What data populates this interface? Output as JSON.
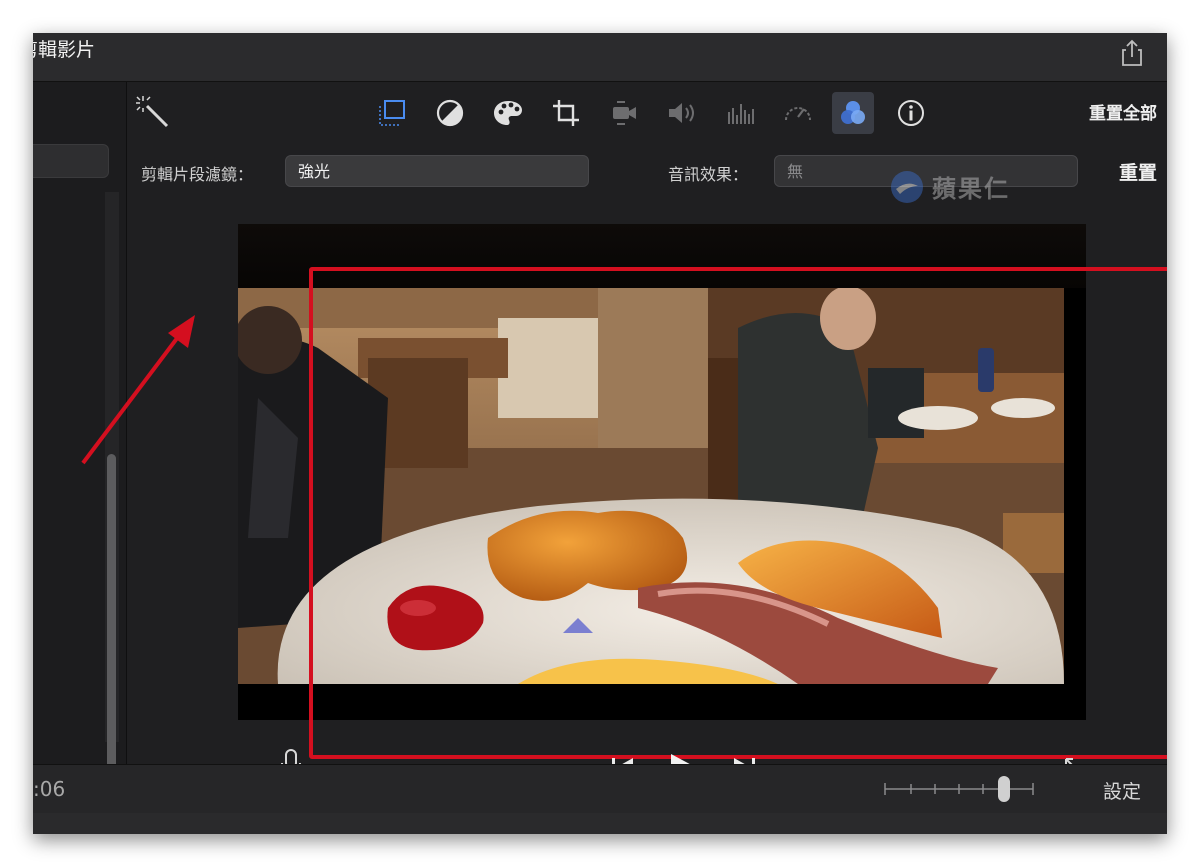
{
  "window": {
    "title": "剪輯影片"
  },
  "toolbar": {
    "tools": [
      "crop-to-fill-icon",
      "color-balance-icon",
      "color-palette-icon",
      "crop-icon",
      "stabilization-icon",
      "volume-icon",
      "equalizer-icon",
      "speed-icon",
      "filters-icon",
      "info-icon"
    ],
    "active_tool": "filters-icon",
    "reset_all_label": "重置全部"
  },
  "filter_row": {
    "clip_filter_label": "剪輯片段濾鏡：",
    "clip_filter_value": "強光",
    "audio_effect_label": "音訊效果：",
    "audio_effect_value": "無",
    "reset_label": "重置"
  },
  "watermark": {
    "text": "蘋果仁"
  },
  "playback": {
    "controls": [
      "mic-icon",
      "skip-back-icon",
      "play-icon",
      "skip-forward-icon",
      "fullscreen-icon"
    ]
  },
  "timeline": {
    "timecode": ":06",
    "settings_label": "設定"
  },
  "colors": {
    "annotation_red": "#d40f1f",
    "active_tool_bg": "#3a3d45",
    "filter_icon_blue": "#4a8cf0"
  }
}
